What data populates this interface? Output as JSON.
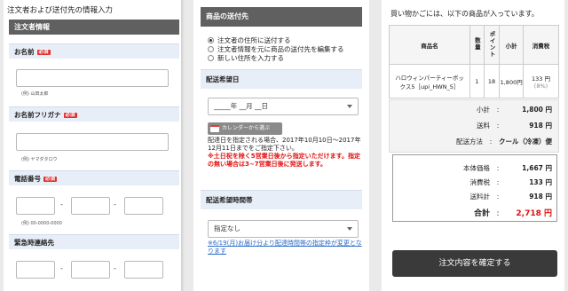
{
  "panel1": {
    "heading": "注文者および送付先の情報入力",
    "section_title": "注文者情報",
    "required_badge": "必須",
    "name_label": "お名前",
    "name_example": "(例) 山田太郎",
    "furigana_label": "お名前フリガナ",
    "furigana_example": "(例) ヤマダタロウ",
    "phone_label": "電話番号",
    "phone_example": "(例) 00-0000-0000",
    "dash": "-",
    "emergency_label": "緊急時連絡先"
  },
  "panel2": {
    "header": "商品の送付先",
    "radio_options": [
      "注文者の住所に送付する",
      "注文者情報を元に商品の送付先を編集する",
      "新しい住所を入力する"
    ],
    "date_label": "配送希望日",
    "date_placeholder": "_____年 __月 __日",
    "calendar_button": "カレンダーから選ぶ",
    "date_note": "配達日を指定される場合、2017年10月10日～2017年12月11日までをご指定下さい。",
    "date_note_red": "※土日祝を除く5営業日後から指定いただけます。指定の無い場合は3~7営業日後に発送します。",
    "time_label": "配送希望時間帯",
    "time_value": "指定なし",
    "time_note": "※6/19(月)お届け分より配達時間帯の指定枠が変更となります"
  },
  "panel3": {
    "intro": "買い物かごには、以下の商品が入っています。",
    "table_headers": [
      "商品名",
      "数量",
      "ポイント",
      "小計",
      "消費税"
    ],
    "item": {
      "name": "ハロウィンパーティーボックス5［upi_HWN_5］",
      "qty": "1",
      "points": "18",
      "subtotal": "1,800円",
      "tax": "133 円",
      "tax_rate": "(8%)"
    },
    "subtotal_label": "小計",
    "subtotal_value": "1,800 円",
    "shipping_label": "送料",
    "shipping_value": "918 円",
    "method_label": "配送方法",
    "method_value": "クール（冷凍）便",
    "base_label": "本体価格",
    "base_value": "1,667 円",
    "tax_label": "消費税",
    "tax_value": "133 円",
    "ship_total_label": "送料計",
    "ship_total_value": "918 円",
    "total_label": "合計",
    "total_value": "2,718 円",
    "confirm_button": "注文内容を確定する",
    "colon": ":"
  }
}
